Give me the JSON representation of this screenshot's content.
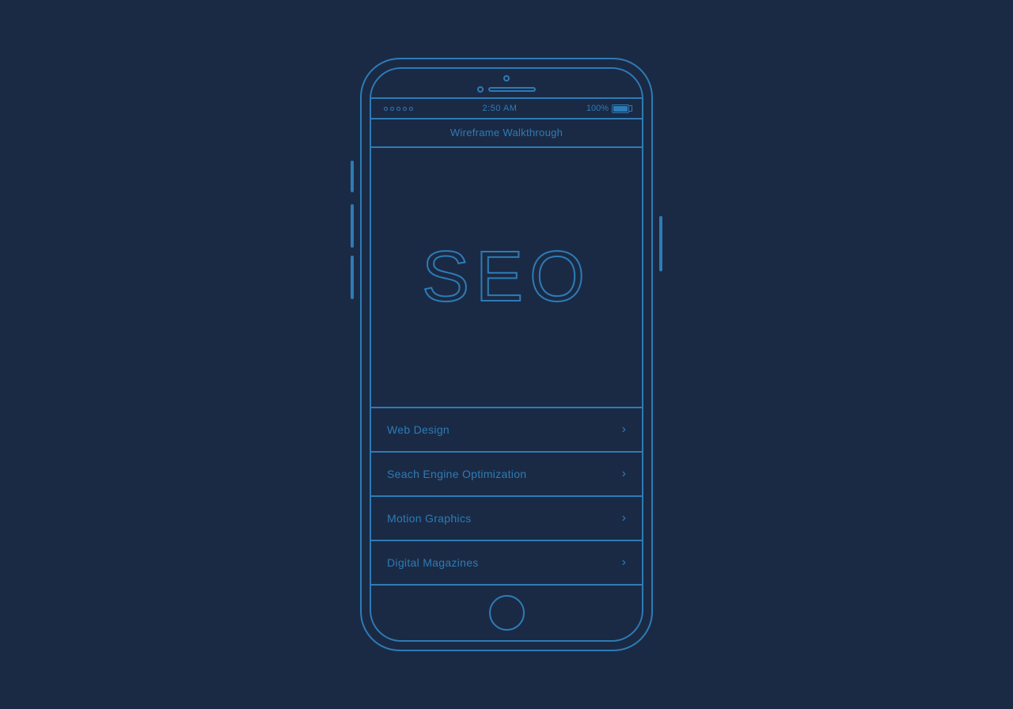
{
  "background": {
    "color": "#1a2a45"
  },
  "phone": {
    "status_bar": {
      "signal_label": "•••••",
      "time": "2:50 AM",
      "battery_percent": "100%"
    },
    "nav": {
      "title": "Wireframe Walkthrough"
    },
    "hero": {
      "text": "SEO"
    },
    "menu": {
      "items": [
        {
          "label": "Web Design",
          "id": "web-design"
        },
        {
          "label": "Seach Engine Optimization",
          "id": "seo"
        },
        {
          "label": "Motion Graphics",
          "id": "motion-graphics"
        },
        {
          "label": "Digital Magazines",
          "id": "digital-magazines"
        }
      ]
    },
    "chevron": "›"
  }
}
